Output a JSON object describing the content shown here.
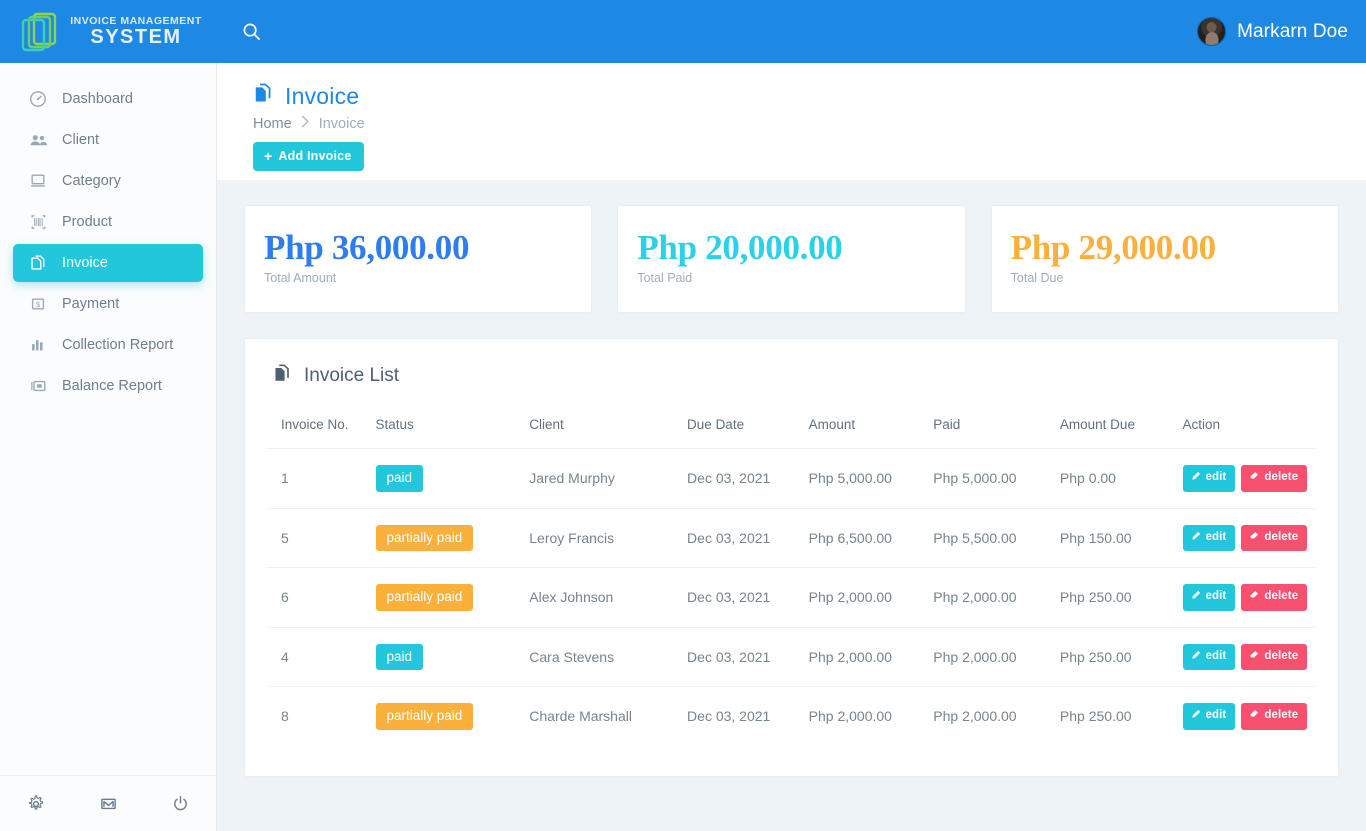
{
  "brand": {
    "line1": "INVOICE MANAGEMENT",
    "line2": "SYSTEM",
    "logo_icon": "stacked-documents-icon"
  },
  "topbar": {
    "search_icon": "search-icon",
    "user_name": "Markarn Doe",
    "avatar_icon": "user-avatar",
    "background_color": "#1e88e5"
  },
  "sidebar": {
    "items": [
      {
        "label": "Dashboard",
        "icon": "speedometer-icon",
        "active": false
      },
      {
        "label": "Client",
        "icon": "people-icon",
        "active": false
      },
      {
        "label": "Category",
        "icon": "monitor-icon",
        "active": false
      },
      {
        "label": "Product",
        "icon": "barcode-icon",
        "active": false
      },
      {
        "label": "Invoice",
        "icon": "document-icon",
        "active": true
      },
      {
        "label": "Payment",
        "icon": "banknote-icon",
        "active": false
      },
      {
        "label": "Collection Report",
        "icon": "bar-chart-icon",
        "active": false
      },
      {
        "label": "Balance Report",
        "icon": "money-card-icon",
        "active": false
      }
    ],
    "footer_icons": [
      "gear-icon",
      "mail-icon",
      "power-icon"
    ],
    "active_color": "#22c7dc"
  },
  "page": {
    "title": "Invoice",
    "title_icon": "document-icon",
    "title_color": "#1e88e5",
    "breadcrumb": {
      "home": "Home",
      "separator": "›",
      "current": "Invoice"
    },
    "add_button": {
      "plus": "+",
      "label": "Add Invoice"
    }
  },
  "stats": [
    {
      "value": "Php 36,000.00",
      "label": "Total Amount",
      "color": "#2e7df0"
    },
    {
      "value": "Php 20,000.00",
      "label": "Total Paid",
      "color": "#2ad2e8"
    },
    {
      "value": "Php 29,000.00",
      "label": "Total Due",
      "color": "#fbb03b"
    }
  ],
  "invoice_list": {
    "title": "Invoice List",
    "title_icon": "document-icon",
    "columns": [
      "Invoice No.",
      "Status",
      "Client",
      "Due Date",
      "Amount",
      "Paid",
      "Amount Due",
      "Action"
    ],
    "action_labels": {
      "edit": "edit",
      "delete": "delete"
    },
    "action_icons": {
      "edit": "pencil-icon",
      "delete": "eraser-icon"
    },
    "rows": [
      {
        "no": "1",
        "status": "paid",
        "status_type": "paid",
        "client": "Jared Murphy",
        "due_date": "Dec 03, 2021",
        "amount": "Php 5,000.00",
        "paid": "Php 5,000.00",
        "amount_due": "Php 0.00"
      },
      {
        "no": "5",
        "status": "partially paid",
        "status_type": "partial",
        "client": "Leroy Francis",
        "due_date": "Dec 03, 2021",
        "amount": "Php 6,500.00",
        "paid": "Php 5,500.00",
        "amount_due": "Php 150.00"
      },
      {
        "no": "6",
        "status": "partially paid",
        "status_type": "partial",
        "client": "Alex Johnson",
        "due_date": "Dec 03, 2021",
        "amount": "Php 2,000.00",
        "paid": "Php 2,000.00",
        "amount_due": "Php 250.00"
      },
      {
        "no": "4",
        "status": "paid",
        "status_type": "paid",
        "client": "Cara Stevens",
        "due_date": "Dec 03, 2021",
        "amount": "Php 2,000.00",
        "paid": "Php 2,000.00",
        "amount_due": "Php 250.00"
      },
      {
        "no": "8",
        "status": "partially paid",
        "status_type": "partial",
        "client": "Charde Marshall",
        "due_date": "Dec 03, 2021",
        "amount": "Php 2,000.00",
        "paid": "Php 2,000.00",
        "amount_due": "Php 250.00"
      }
    ]
  },
  "colors": {
    "header_blue": "#1e88e5",
    "accent_teal": "#22c7dc",
    "warn_orange": "#fbb03b",
    "danger_pink": "#f8506f",
    "page_bg": "#eef3f7"
  }
}
